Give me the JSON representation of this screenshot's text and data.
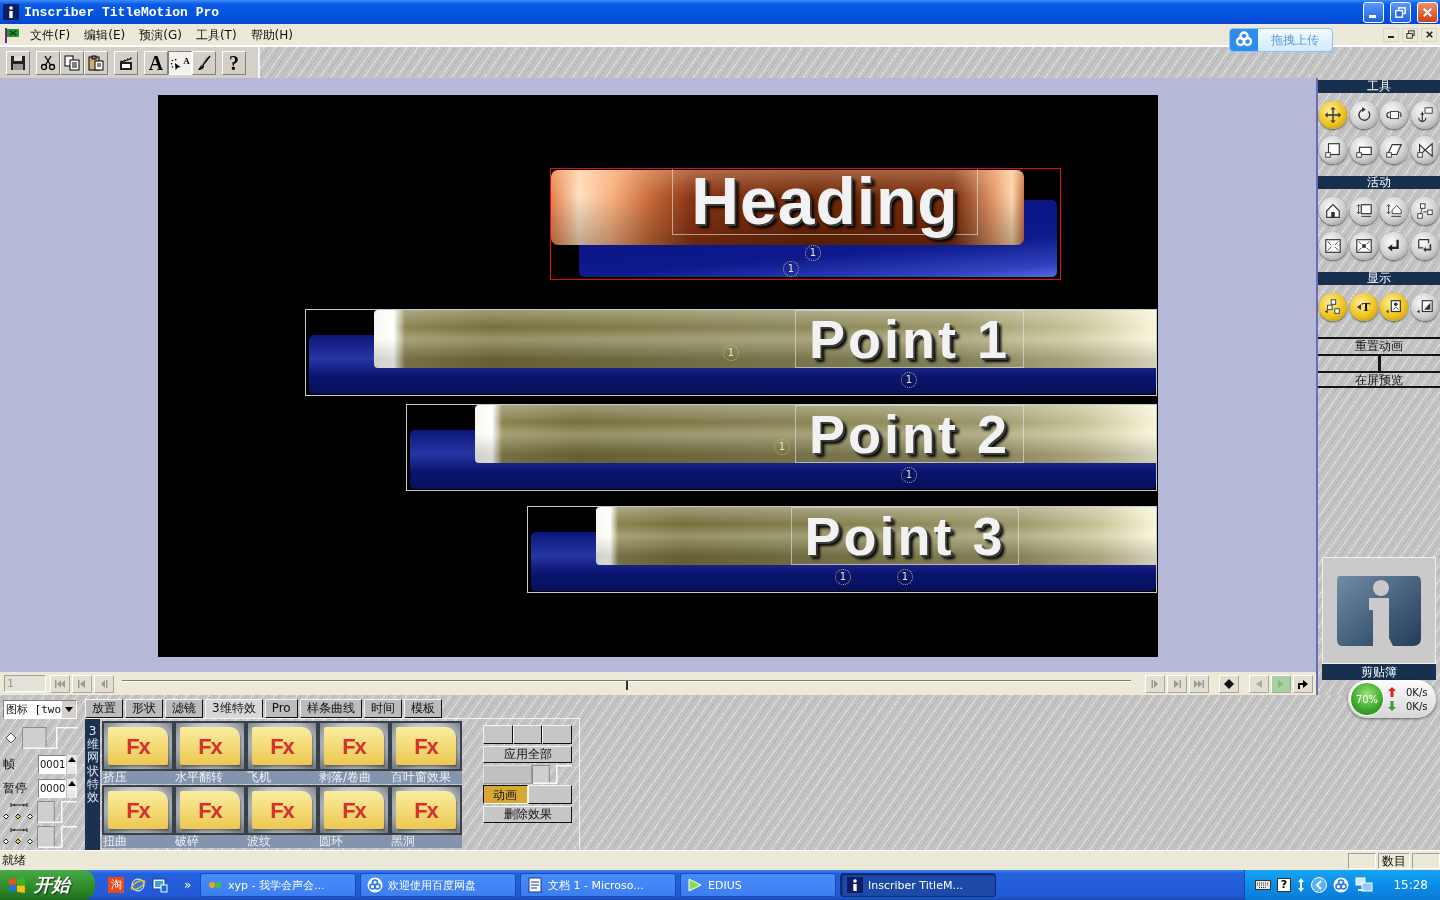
{
  "window": {
    "title": "Inscriber TitleMotion Pro"
  },
  "menu": [
    {
      "label": "文件(F)"
    },
    {
      "label": "编辑(E)"
    },
    {
      "label": "预演(G)"
    },
    {
      "label": "工具(T)"
    },
    {
      "label": "帮助(H)"
    }
  ],
  "toolbar": [
    [
      {
        "pressed": false
      }
    ],
    [
      {
        "pressed": false
      },
      {
        "pressed": false
      },
      {
        "pressed": false
      }
    ],
    [
      {
        "pressed": false
      }
    ],
    [
      {
        "text": "A",
        "pressed": false
      },
      {
        "text": "A",
        "pressed": true
      },
      {
        "pressed": false
      }
    ],
    [
      {
        "text": "?",
        "pressed": false
      }
    ]
  ],
  "upload_widget": {
    "label": "拖拽上传"
  },
  "canvas": {
    "objects": [
      {
        "kind": "heading",
        "text": "Heading",
        "selected": true,
        "markers": [
          "1",
          "1"
        ]
      },
      {
        "kind": "point",
        "text": "Point 1",
        "selected": false,
        "markers": [
          "1",
          "1"
        ]
      },
      {
        "kind": "point",
        "text": "Point 2",
        "selected": false,
        "markers": [
          "1",
          "1"
        ]
      },
      {
        "kind": "point",
        "text": "Point 3",
        "selected": false,
        "markers": [
          "1",
          "1"
        ]
      }
    ]
  },
  "timeline": {
    "frame": "1",
    "level": 0.5
  },
  "tool_panel": {
    "sections": [
      {
        "title": "工具",
        "buttons": [
          {
            "selected": true
          },
          {
            "selected": false
          },
          {
            "selected": false
          },
          {
            "selected": false
          },
          {
            "selected": false
          },
          {
            "selected": false
          },
          {
            "selected": false
          },
          {
            "selected": false
          }
        ]
      },
      {
        "title": "活动"
      },
      {
        "title": "显示",
        "buttons": [
          {
            "on": true
          },
          {
            "on": true,
            "text": "T"
          },
          {
            "on": true
          },
          {
            "on": false
          }
        ]
      }
    ],
    "buttons": [
      {
        "kind": "single",
        "label": "重置动画"
      },
      {
        "kind": "pair"
      },
      {
        "kind": "single",
        "label": "在屏预览"
      }
    ],
    "clipboard": {
      "label": "剪贴簿"
    }
  },
  "speed_widget": {
    "percent": "70%",
    "upload": "0K/s",
    "download": "0K/s"
  },
  "properties": {
    "view": "图标 [two",
    "frame_label": "帧",
    "frame": "0001",
    "pause_label": "暂停",
    "pause": "0000",
    "toggles": [
      {
        "on": false
      },
      {
        "on": false
      },
      {
        "on": false
      }
    ]
  },
  "tabs": [
    {
      "label": "放置",
      "selected": false
    },
    {
      "label": "形状",
      "selected": false
    },
    {
      "label": "滤镜",
      "selected": false
    },
    {
      "label": "3维特效",
      "selected": true
    },
    {
      "label": "Pro",
      "selected": false
    },
    {
      "label": "样条曲线",
      "selected": false
    },
    {
      "label": "时间",
      "selected": false
    },
    {
      "label": "模板",
      "selected": false
    }
  ],
  "effects": {
    "title": "3维网状特效",
    "items": [
      {
        "label": "挤压",
        "badge": "Fx"
      },
      {
        "label": "水平翻转",
        "badge": "Fx"
      },
      {
        "label": "飞机",
        "badge": "Fx"
      },
      {
        "label": "剥落/卷曲",
        "badge": "Fx"
      },
      {
        "label": "百叶窗效果",
        "badge": "Fx"
      },
      {
        "label": "扭曲",
        "badge": "Fx"
      },
      {
        "label": "破碎",
        "badge": "Fx"
      },
      {
        "label": "波纹",
        "badge": "Fx"
      },
      {
        "label": "圆环",
        "badge": "Fx"
      },
      {
        "label": "黑洞",
        "badge": "Fx"
      }
    ]
  },
  "effect_buttons": {
    "apply_all": "应用全部",
    "toggle": {
      "on": false
    },
    "animate": {
      "label": "动画",
      "selected": true
    },
    "delete": "删除效果"
  },
  "status_bar": {
    "message": "就绪",
    "panels": [
      "数目"
    ]
  },
  "taskbar": {
    "start": "开始",
    "shop_badge": "淘",
    "more": "»",
    "tasks": [
      {
        "label": "xyp - 我学会声会...",
        "selected": false
      },
      {
        "label": "欢迎使用百度网盘",
        "selected": false
      },
      {
        "label": "文档 1 - Microso...",
        "selected": false
      },
      {
        "label": "EDIUS",
        "selected": false
      },
      {
        "label": "Inscriber TitleM...",
        "selected": true
      }
    ],
    "tray": {
      "help": "?",
      "clock": "15:28"
    }
  }
}
